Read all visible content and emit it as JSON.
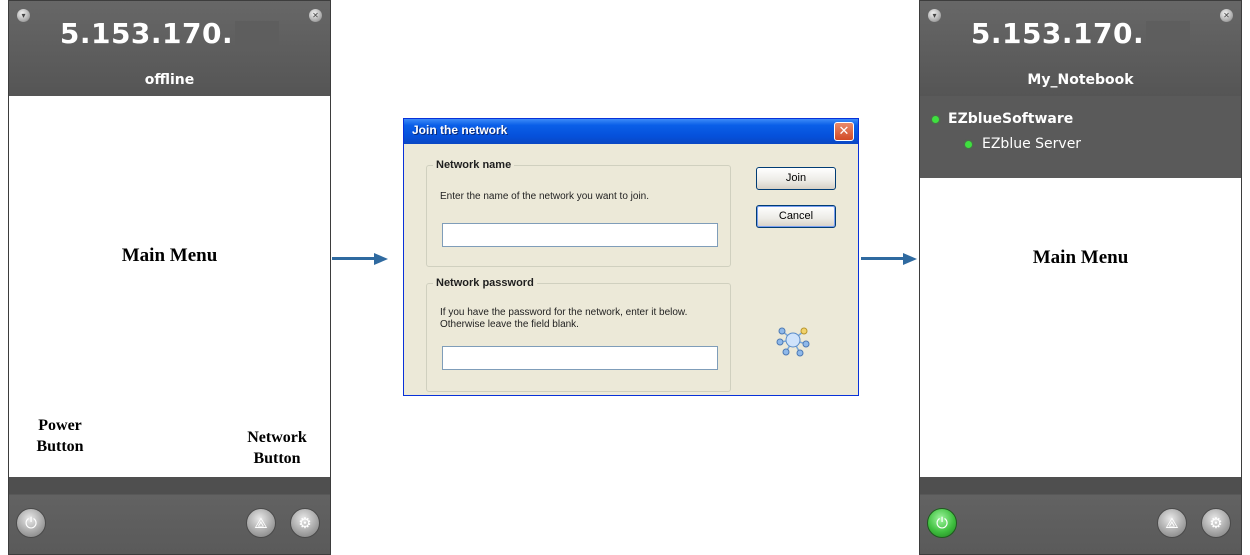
{
  "left_panel": {
    "ip_address": "5.153.170.",
    "status": "offline",
    "main_label": "Main Menu",
    "power_label_line1": "Power",
    "power_label_line2": "Button",
    "network_label_line1": "Network",
    "network_label_line2": "Button",
    "power_state": "off"
  },
  "dialog": {
    "title": "Join the network",
    "close_glyph": "✕",
    "name_group": {
      "legend": "Network name",
      "help": "Enter the name of the network you want to join.",
      "value": ""
    },
    "password_group": {
      "legend": "Network password",
      "help": "If you have the password for the network, enter it below. Otherwise leave the field blank.",
      "value": ""
    },
    "join_label": "Join",
    "cancel_label": "Cancel"
  },
  "right_panel": {
    "ip_address": "5.153.170.",
    "client_name": "My_Notebook",
    "network_name": "EZblueSoftware",
    "member_name": "EZblue Server",
    "main_label": "Main Menu",
    "power_state": "on",
    "status_color": "#3fe03f"
  },
  "icons": {
    "corner_left": "▾",
    "corner_right": "✕",
    "power": "⏻",
    "network": "⟁",
    "settings": "⚙"
  },
  "colors": {
    "panel_bg": "#565656",
    "arrow": "#2f6aa0",
    "titlebar": "#0550da",
    "dialog_bg": "#ece9d8"
  }
}
